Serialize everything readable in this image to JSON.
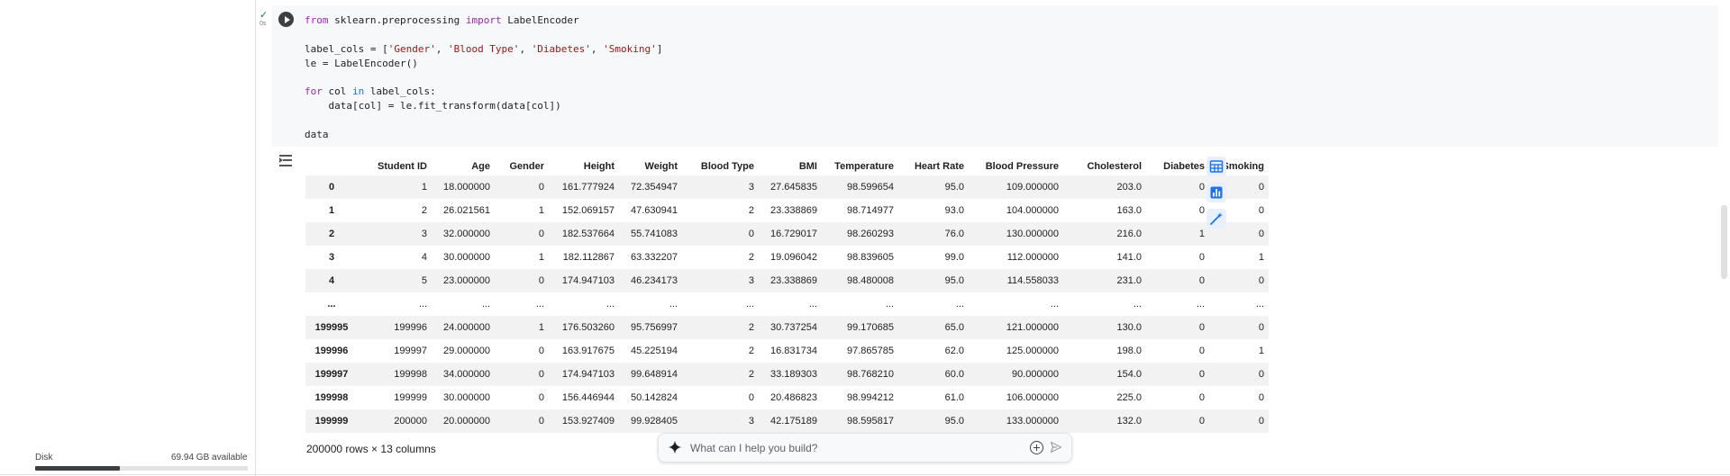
{
  "left_panel": {
    "disk_label": "Disk",
    "disk_available": "69.94 GB available",
    "disk_used_fraction": 0.4
  },
  "cell": {
    "status_check": "✓",
    "exec_time": "0s",
    "code_lines": [
      [
        {
          "t": "from",
          "c": "kw"
        },
        {
          "t": " sklearn.preprocessing ",
          "c": "blk"
        },
        {
          "t": "import",
          "c": "kw"
        },
        {
          "t": " LabelEncoder",
          "c": "blk"
        }
      ],
      [],
      [
        {
          "t": "label_cols = [",
          "c": "blk"
        },
        {
          "t": "'Gender'",
          "c": "str"
        },
        {
          "t": ", ",
          "c": "blk"
        },
        {
          "t": "'Blood Type'",
          "c": "str"
        },
        {
          "t": ", ",
          "c": "blk"
        },
        {
          "t": "'Diabetes'",
          "c": "str"
        },
        {
          "t": ", ",
          "c": "blk"
        },
        {
          "t": "'Smoking'",
          "c": "str"
        },
        {
          "t": "]",
          "c": "blk"
        }
      ],
      [
        {
          "t": "le = LabelEncoder()",
          "c": "blk"
        }
      ],
      [],
      [
        {
          "t": "for",
          "c": "kw"
        },
        {
          "t": " col ",
          "c": "blk"
        },
        {
          "t": "in",
          "c": "kw2"
        },
        {
          "t": " label_cols:",
          "c": "blk"
        }
      ],
      [
        {
          "t": "    data[col] = le.fit_transform(data[col])",
          "c": "blk"
        }
      ],
      [],
      [
        {
          "t": "data",
          "c": "blk"
        }
      ]
    ]
  },
  "dataframe": {
    "columns": [
      "",
      "Student ID",
      "Age",
      "Gender",
      "Height",
      "Weight",
      "Blood Type",
      "BMI",
      "Temperature",
      "Heart Rate",
      "Blood Pressure",
      "Cholesterol",
      "Diabetes",
      "Smoking"
    ],
    "rows": [
      [
        "0",
        "1",
        "18.000000",
        "0",
        "161.777924",
        "72.354947",
        "3",
        "27.645835",
        "98.599654",
        "95.0",
        "109.000000",
        "203.0",
        "0",
        "0"
      ],
      [
        "1",
        "2",
        "26.021561",
        "1",
        "152.069157",
        "47.630941",
        "2",
        "23.338869",
        "98.714977",
        "93.0",
        "104.000000",
        "163.0",
        "0",
        "0"
      ],
      [
        "2",
        "3",
        "32.000000",
        "0",
        "182.537664",
        "55.741083",
        "0",
        "16.729017",
        "98.260293",
        "76.0",
        "130.000000",
        "216.0",
        "1",
        "0"
      ],
      [
        "3",
        "4",
        "30.000000",
        "1",
        "182.112867",
        "63.332207",
        "2",
        "19.096042",
        "98.839605",
        "99.0",
        "112.000000",
        "141.0",
        "0",
        "1"
      ],
      [
        "4",
        "5",
        "23.000000",
        "0",
        "174.947103",
        "46.234173",
        "3",
        "23.338869",
        "98.480008",
        "95.0",
        "114.558033",
        "231.0",
        "0",
        "0"
      ],
      [
        "...",
        "...",
        "...",
        "...",
        "...",
        "...",
        "...",
        "...",
        "...",
        "...",
        "...",
        "...",
        "...",
        "..."
      ],
      [
        "199995",
        "199996",
        "24.000000",
        "1",
        "176.503260",
        "95.756997",
        "2",
        "30.737254",
        "99.170685",
        "65.0",
        "121.000000",
        "130.0",
        "0",
        "0"
      ],
      [
        "199996",
        "199997",
        "29.000000",
        "0",
        "163.917675",
        "45.225194",
        "2",
        "16.831734",
        "97.865785",
        "62.0",
        "125.000000",
        "198.0",
        "0",
        "1"
      ],
      [
        "199997",
        "199998",
        "34.000000",
        "0",
        "174.947103",
        "99.648914",
        "2",
        "33.189303",
        "98.768210",
        "60.0",
        "90.000000",
        "154.0",
        "0",
        "0"
      ],
      [
        "199998",
        "199999",
        "30.000000",
        "0",
        "156.446944",
        "50.142824",
        "0",
        "20.486823",
        "98.994212",
        "61.0",
        "106.000000",
        "225.0",
        "0",
        "0"
      ],
      [
        "199999",
        "200000",
        "20.000000",
        "0",
        "153.927409",
        "99.928405",
        "3",
        "42.175189",
        "98.595817",
        "95.0",
        "133.000000",
        "132.0",
        "0",
        "0"
      ]
    ],
    "shape_label": "200000 rows × 13 columns"
  },
  "side_icons": [
    "table-icon",
    "chart-icon",
    "magic-wand-icon"
  ],
  "prompt": {
    "placeholder": "What can I help you build?"
  },
  "colors": {
    "accent": "#1a73e8",
    "keyword": "#9c27b0",
    "string": "#a31515",
    "success": "#188038"
  }
}
